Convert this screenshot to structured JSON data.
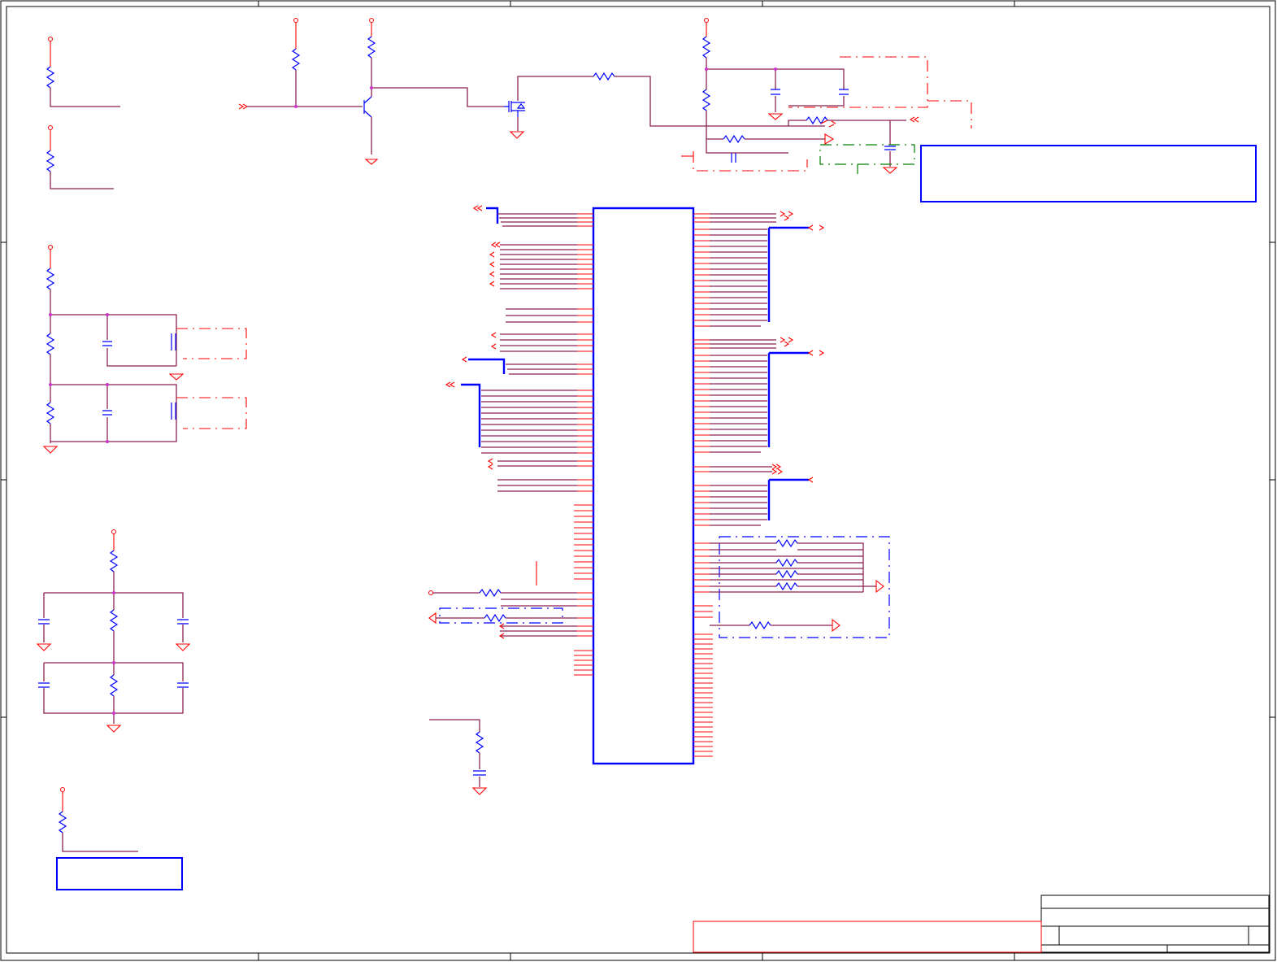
{
  "sheet": {
    "type": "electronic schematic sheet",
    "labels_legible": false
  },
  "colors": {
    "wire": "#8b2252",
    "pin": "#ff0000",
    "component": "#0000ff",
    "junction": "#cc33cc",
    "zone": "#008000"
  }
}
